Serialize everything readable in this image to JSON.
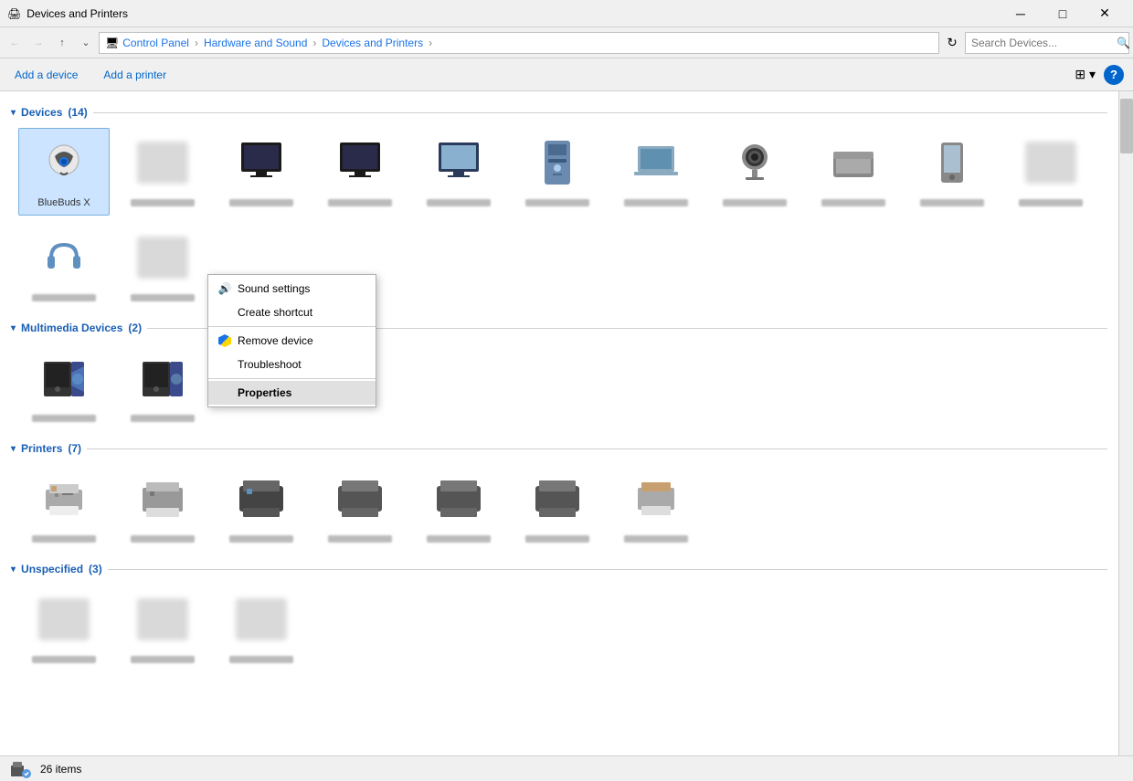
{
  "window": {
    "title": "Devices and Printers",
    "icon": "📠"
  },
  "titlebar": {
    "minimize": "─",
    "maximize": "□",
    "close": "✕"
  },
  "breadcrumb": {
    "control_panel": "Control Panel",
    "hardware_sound": "Hardware and Sound",
    "devices_printers": "Devices and Printers",
    "separator": "›"
  },
  "search": {
    "placeholder": "Search Devices..."
  },
  "toolbar": {
    "add_device": "Add a device",
    "add_printer": "Add a printer"
  },
  "sections": {
    "devices": {
      "label": "Devices",
      "count": "(14)"
    },
    "multimedia": {
      "label": "Multimedia Devices",
      "count": "(2)"
    },
    "printers": {
      "label": "Printers",
      "count": "(7)"
    },
    "unspecified": {
      "label": "Unspecified",
      "count": "(3)"
    }
  },
  "context_menu": {
    "selected_device": "BlueBuds X",
    "items": [
      {
        "id": "sound-settings",
        "label": "Sound settings",
        "icon": "speaker",
        "has_shield": false
      },
      {
        "id": "create-shortcut",
        "label": "Create shortcut",
        "icon": "",
        "has_shield": false
      },
      {
        "id": "remove-device",
        "label": "Remove device",
        "icon": "shield",
        "has_shield": true
      },
      {
        "id": "troubleshoot",
        "label": "Troubleshoot",
        "icon": "",
        "has_shield": false
      },
      {
        "id": "properties",
        "label": "Properties",
        "icon": "",
        "has_shield": false,
        "active": true
      }
    ]
  },
  "status_bar": {
    "item_count": "26 items"
  }
}
